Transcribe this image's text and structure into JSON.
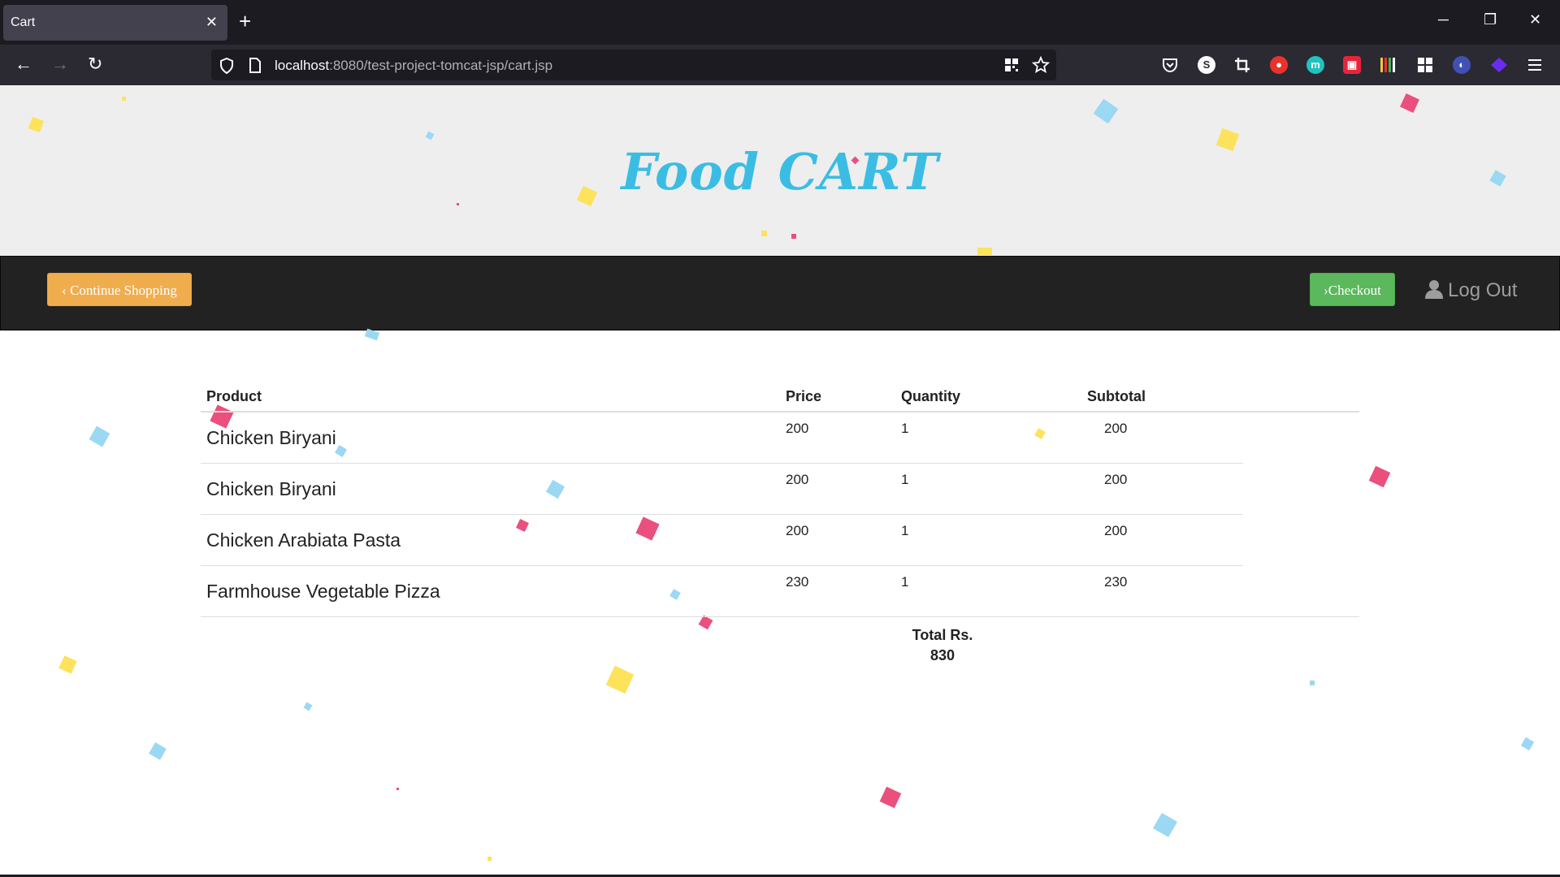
{
  "browser": {
    "tab_title": "Cart",
    "tab_close": "✕",
    "new_tab": "+",
    "url_host": "localhost",
    "url_rest": ":8080/test-project-tomcat-jsp/cart.jsp",
    "window_controls": {
      "minimize": "─",
      "restore": "❐",
      "close": "✕"
    },
    "nav": {
      "back": "←",
      "forward": "→",
      "reload": "↻"
    }
  },
  "header": {
    "brand": "Food CART"
  },
  "nav": {
    "continue_label": "Continue Shopping",
    "continue_icon": "‹",
    "checkout_label": "Checkout",
    "checkout_icon": "›",
    "logout_label": "Log Out"
  },
  "cart": {
    "columns": {
      "product": "Product",
      "price": "Price",
      "quantity": "Quantity",
      "subtotal": "Subtotal"
    },
    "items": [
      {
        "name": "Chicken Biryani",
        "price": "200",
        "quantity": "1",
        "subtotal": "200"
      },
      {
        "name": "Chicken Biryani",
        "price": "200",
        "quantity": "1",
        "subtotal": "200"
      },
      {
        "name": "Chicken Arabiata Pasta",
        "price": "200",
        "quantity": "1",
        "subtotal": "200"
      },
      {
        "name": "Farmhouse Vegetable Pizza",
        "price": "230",
        "quantity": "1",
        "subtotal": "230"
      }
    ],
    "total_label": "Total Rs.",
    "total_value": "830"
  },
  "colors": {
    "brand": "#3bbde3",
    "continue_button": "#f0ad4e",
    "checkout_button": "#5cb85c",
    "nav_background": "#222222",
    "header_background": "#eeeeee",
    "confetti": [
      "#fde25b",
      "#9bd8f4",
      "#eb4f7d"
    ]
  }
}
